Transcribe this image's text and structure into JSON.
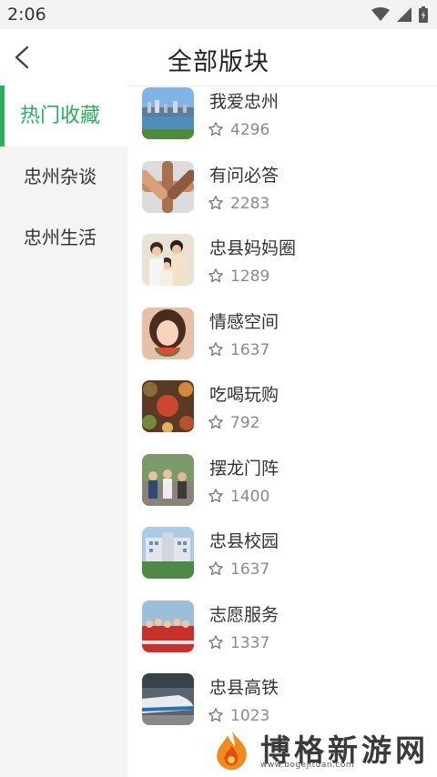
{
  "status_bar": {
    "time": "2:06"
  },
  "header": {
    "title": "全部版块"
  },
  "sidebar": {
    "items": [
      {
        "label": "热门收藏",
        "active": true
      },
      {
        "label": "忠州杂谈",
        "active": false
      },
      {
        "label": "忠州生活",
        "active": false
      }
    ]
  },
  "boards": [
    {
      "name": "我爱忠州",
      "count": "4296",
      "thumb_icon": "city-lake-photo"
    },
    {
      "name": "有问必答",
      "count": "2283",
      "thumb_icon": "joined-hands-photo"
    },
    {
      "name": "忠县妈妈圈",
      "count": "1289",
      "thumb_icon": "family-photo"
    },
    {
      "name": "情感空间",
      "count": "1637",
      "thumb_icon": "girl-watermelon-photo"
    },
    {
      "name": "吃喝玩购",
      "count": "792",
      "thumb_icon": "food-dishes-photo"
    },
    {
      "name": "摆龙门阵",
      "count": "1400",
      "thumb_icon": "group-people-photo"
    },
    {
      "name": "忠县校园",
      "count": "1637",
      "thumb_icon": "school-building-photo"
    },
    {
      "name": "志愿服务",
      "count": "1337",
      "thumb_icon": "volunteers-photo"
    },
    {
      "name": "忠县高铁",
      "count": "1023",
      "thumb_icon": "bullet-train-photo"
    }
  ],
  "watermark": {
    "text": "博格新游网",
    "url": "www.bogejituan.com"
  },
  "colors": {
    "accent": "#2cae5c",
    "sidebar_bg": "#f4f4f4"
  }
}
